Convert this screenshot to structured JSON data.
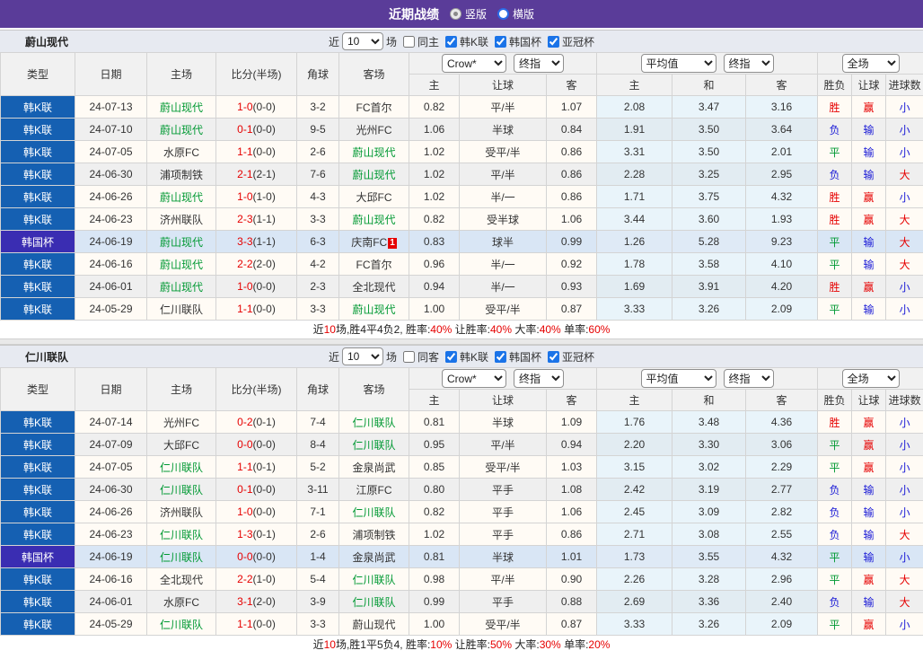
{
  "title_bar": {
    "title": "近期战绩",
    "radio_vertical": "竖版",
    "radio_horizontal": "横版"
  },
  "filter": {
    "near": "近",
    "count": "10",
    "games": "场",
    "leagues": [
      "韩K联",
      "韩国杯",
      "亚冠杯"
    ]
  },
  "dropdowns": {
    "company": "Crow*",
    "final1": "终指",
    "average": "平均值",
    "final2": "终指",
    "scope": "全场"
  },
  "cols": {
    "type": "类型",
    "date": "日期",
    "home": "主场",
    "score": "比分(半场)",
    "corner": "角球",
    "away": "客场",
    "home_odds": "主",
    "handicap": "让球",
    "away_odds": "客",
    "avg_home": "主",
    "avg_draw": "和",
    "avg_away": "客",
    "result": "胜负",
    "handicap_result": "让球",
    "goals": "进球数"
  },
  "colors": {
    "titlebar_bg": "#5a3c99",
    "league_bg": "#1560b2",
    "cup_bg": "#3a2db2",
    "team_green": "#009933",
    "score_red": "#e60000",
    "win_red": "#e60000",
    "lose_blue": "#1a1ad6",
    "draw_green": "#009933",
    "row_light": "#fffbf5",
    "row_gray": "#efefef",
    "row_highlight": "#d9e6f5",
    "avg_col_bg": "#e9f4fa"
  },
  "sections": [
    {
      "team": "蔚山现代",
      "same_label": "同主",
      "rows": [
        {
          "t": "韩K联",
          "cup": false,
          "d": "24-07-13",
          "h": "蔚山现代",
          "hg": true,
          "s": "1-0",
          "sh": "(0-0)",
          "c": "3-2",
          "a": "FC首尔",
          "ag": false,
          "o1": "0.82",
          "hc": "平/半",
          "o2": "1.07",
          "v1": "2.08",
          "v2": "3.47",
          "v3": "3.16",
          "r": "胜",
          "rc": "r",
          "hr": "赢",
          "hrc": "r",
          "g": "小",
          "gc": "b",
          "shade": "w"
        },
        {
          "t": "韩K联",
          "cup": false,
          "d": "24-07-10",
          "h": "蔚山现代",
          "hg": true,
          "s": "0-1",
          "sh": "(0-0)",
          "c": "9-5",
          "a": "光州FC",
          "ag": false,
          "o1": "1.06",
          "hc": "半球",
          "o2": "0.84",
          "v1": "1.91",
          "v2": "3.50",
          "v3": "3.64",
          "r": "负",
          "rc": "b",
          "hr": "输",
          "hrc": "b",
          "g": "小",
          "gc": "b",
          "shade": "g"
        },
        {
          "t": "韩K联",
          "cup": false,
          "d": "24-07-05",
          "h": "水原FC",
          "hg": false,
          "s": "1-1",
          "sh": "(0-0)",
          "c": "2-6",
          "a": "蔚山现代",
          "ag": true,
          "o1": "1.02",
          "hc": "受平/半",
          "o2": "0.86",
          "v1": "3.31",
          "v2": "3.50",
          "v3": "2.01",
          "r": "平",
          "rc": "g",
          "hr": "输",
          "hrc": "b",
          "g": "小",
          "gc": "b",
          "shade": "w"
        },
        {
          "t": "韩K联",
          "cup": false,
          "d": "24-06-30",
          "h": "浦项制铁",
          "hg": false,
          "s": "2-1",
          "sh": "(2-1)",
          "c": "7-6",
          "a": "蔚山现代",
          "ag": true,
          "o1": "1.02",
          "hc": "平/半",
          "o2": "0.86",
          "v1": "2.28",
          "v2": "3.25",
          "v3": "2.95",
          "r": "负",
          "rc": "b",
          "hr": "输",
          "hrc": "b",
          "g": "大",
          "gc": "r",
          "shade": "g"
        },
        {
          "t": "韩K联",
          "cup": false,
          "d": "24-06-26",
          "h": "蔚山现代",
          "hg": true,
          "s": "1-0",
          "sh": "(1-0)",
          "c": "4-3",
          "a": "大邱FC",
          "ag": false,
          "o1": "1.02",
          "hc": "半/一",
          "o2": "0.86",
          "v1": "1.71",
          "v2": "3.75",
          "v3": "4.32",
          "r": "胜",
          "rc": "r",
          "hr": "赢",
          "hrc": "r",
          "g": "小",
          "gc": "b",
          "shade": "w"
        },
        {
          "t": "韩K联",
          "cup": false,
          "d": "24-06-23",
          "h": "济州联队",
          "hg": false,
          "s": "2-3",
          "sh": "(1-1)",
          "c": "3-3",
          "a": "蔚山现代",
          "ag": true,
          "o1": "0.82",
          "hc": "受半球",
          "o2": "1.06",
          "v1": "3.44",
          "v2": "3.60",
          "v3": "1.93",
          "r": "胜",
          "rc": "r",
          "hr": "赢",
          "hrc": "r",
          "g": "大",
          "gc": "r",
          "shade": "w"
        },
        {
          "t": "韩国杯",
          "cup": true,
          "d": "24-06-19",
          "h": "蔚山现代",
          "hg": true,
          "s": "3-3",
          "sh": "(1-1)",
          "c": "6-3",
          "a": "庆南FC",
          "ag": false,
          "ab": "1",
          "o1": "0.83",
          "hc": "球半",
          "o2": "0.99",
          "v1": "1.26",
          "v2": "5.28",
          "v3": "9.23",
          "r": "平",
          "rc": "g",
          "hr": "输",
          "hrc": "b",
          "g": "大",
          "gc": "r",
          "shade": "hl"
        },
        {
          "t": "韩K联",
          "cup": false,
          "d": "24-06-16",
          "h": "蔚山现代",
          "hg": true,
          "s": "2-2",
          "sh": "(2-0)",
          "c": "4-2",
          "a": "FC首尔",
          "ag": false,
          "o1": "0.96",
          "hc": "半/一",
          "o2": "0.92",
          "v1": "1.78",
          "v2": "3.58",
          "v3": "4.10",
          "r": "平",
          "rc": "g",
          "hr": "输",
          "hrc": "b",
          "g": "大",
          "gc": "r",
          "shade": "w"
        },
        {
          "t": "韩K联",
          "cup": false,
          "d": "24-06-01",
          "h": "蔚山现代",
          "hg": true,
          "s": "1-0",
          "sh": "(0-0)",
          "c": "2-3",
          "a": "全北现代",
          "ag": false,
          "o1": "0.94",
          "hc": "半/一",
          "o2": "0.93",
          "v1": "1.69",
          "v2": "3.91",
          "v3": "4.20",
          "r": "胜",
          "rc": "r",
          "hr": "赢",
          "hrc": "r",
          "g": "小",
          "gc": "b",
          "shade": "g"
        },
        {
          "t": "韩K联",
          "cup": false,
          "d": "24-05-29",
          "h": "仁川联队",
          "hg": false,
          "s": "1-1",
          "sh": "(0-0)",
          "c": "3-3",
          "a": "蔚山现代",
          "ag": true,
          "o1": "1.00",
          "hc": "受平/半",
          "o2": "0.87",
          "v1": "3.33",
          "v2": "3.26",
          "v3": "2.09",
          "r": "平",
          "rc": "g",
          "hr": "输",
          "hrc": "b",
          "g": "小",
          "gc": "b",
          "shade": "w"
        }
      ],
      "summary": [
        [
          "近",
          "k"
        ],
        [
          "10",
          "r"
        ],
        [
          "场,胜4平4负2, 胜率:",
          "k"
        ],
        [
          "40%",
          "r"
        ],
        [
          " 让胜率:",
          "k"
        ],
        [
          "40%",
          "r"
        ],
        [
          " 大率:",
          "k"
        ],
        [
          "40%",
          "r"
        ],
        [
          " 单率:",
          "k"
        ],
        [
          "60%",
          "r"
        ]
      ]
    },
    {
      "team": "仁川联队",
      "same_label": "同客",
      "rows": [
        {
          "t": "韩K联",
          "cup": false,
          "d": "24-07-14",
          "h": "光州FC",
          "hg": false,
          "s": "0-2",
          "sh": "(0-1)",
          "c": "7-4",
          "a": "仁川联队",
          "ag": true,
          "o1": "0.81",
          "hc": "半球",
          "o2": "1.09",
          "v1": "1.76",
          "v2": "3.48",
          "v3": "4.36",
          "r": "胜",
          "rc": "r",
          "hr": "赢",
          "hrc": "r",
          "g": "小",
          "gc": "b",
          "shade": "w"
        },
        {
          "t": "韩K联",
          "cup": false,
          "d": "24-07-09",
          "h": "大邱FC",
          "hg": false,
          "s": "0-0",
          "sh": "(0-0)",
          "c": "8-4",
          "a": "仁川联队",
          "ag": true,
          "o1": "0.95",
          "hc": "平/半",
          "o2": "0.94",
          "v1": "2.20",
          "v2": "3.30",
          "v3": "3.06",
          "r": "平",
          "rc": "g",
          "hr": "赢",
          "hrc": "r",
          "g": "小",
          "gc": "b",
          "shade": "g"
        },
        {
          "t": "韩K联",
          "cup": false,
          "d": "24-07-05",
          "h": "仁川联队",
          "hg": true,
          "s": "1-1",
          "sh": "(0-1)",
          "c": "5-2",
          "a": "金泉尚武",
          "ag": false,
          "o1": "0.85",
          "hc": "受平/半",
          "o2": "1.03",
          "v1": "3.15",
          "v2": "3.02",
          "v3": "2.29",
          "r": "平",
          "rc": "g",
          "hr": "赢",
          "hrc": "r",
          "g": "小",
          "gc": "b",
          "shade": "w"
        },
        {
          "t": "韩K联",
          "cup": false,
          "d": "24-06-30",
          "h": "仁川联队",
          "hg": true,
          "s": "0-1",
          "sh": "(0-0)",
          "c": "3-11",
          "a": "江原FC",
          "ag": false,
          "o1": "0.80",
          "hc": "平手",
          "o2": "1.08",
          "v1": "2.42",
          "v2": "3.19",
          "v3": "2.77",
          "r": "负",
          "rc": "b",
          "hr": "输",
          "hrc": "b",
          "g": "小",
          "gc": "b",
          "shade": "g"
        },
        {
          "t": "韩K联",
          "cup": false,
          "d": "24-06-26",
          "h": "济州联队",
          "hg": false,
          "s": "1-0",
          "sh": "(0-0)",
          "c": "7-1",
          "a": "仁川联队",
          "ag": true,
          "o1": "0.82",
          "hc": "平手",
          "o2": "1.06",
          "v1": "2.45",
          "v2": "3.09",
          "v3": "2.82",
          "r": "负",
          "rc": "b",
          "hr": "输",
          "hrc": "b",
          "g": "小",
          "gc": "b",
          "shade": "w"
        },
        {
          "t": "韩K联",
          "cup": false,
          "d": "24-06-23",
          "h": "仁川联队",
          "hg": true,
          "s": "1-3",
          "sh": "(0-1)",
          "c": "2-6",
          "a": "浦项制铁",
          "ag": false,
          "o1": "1.02",
          "hc": "平手",
          "o2": "0.86",
          "v1": "2.71",
          "v2": "3.08",
          "v3": "2.55",
          "r": "负",
          "rc": "b",
          "hr": "输",
          "hrc": "b",
          "g": "大",
          "gc": "r",
          "shade": "w"
        },
        {
          "t": "韩国杯",
          "cup": true,
          "d": "24-06-19",
          "h": "仁川联队",
          "hg": true,
          "s": "0-0",
          "sh": "(0-0)",
          "c": "1-4",
          "a": "金泉尚武",
          "ag": false,
          "o1": "0.81",
          "hc": "半球",
          "o2": "1.01",
          "v1": "1.73",
          "v2": "3.55",
          "v3": "4.32",
          "r": "平",
          "rc": "g",
          "hr": "输",
          "hrc": "b",
          "g": "小",
          "gc": "b",
          "shade": "hl"
        },
        {
          "t": "韩K联",
          "cup": false,
          "d": "24-06-16",
          "h": "全北现代",
          "hg": false,
          "s": "2-2",
          "sh": "(1-0)",
          "c": "5-4",
          "a": "仁川联队",
          "ag": true,
          "o1": "0.98",
          "hc": "平/半",
          "o2": "0.90",
          "v1": "2.26",
          "v2": "3.28",
          "v3": "2.96",
          "r": "平",
          "rc": "g",
          "hr": "赢",
          "hrc": "r",
          "g": "大",
          "gc": "r",
          "shade": "w"
        },
        {
          "t": "韩K联",
          "cup": false,
          "d": "24-06-01",
          "h": "水原FC",
          "hg": false,
          "s": "3-1",
          "sh": "(2-0)",
          "c": "3-9",
          "a": "仁川联队",
          "ag": true,
          "o1": "0.99",
          "hc": "平手",
          "o2": "0.88",
          "v1": "2.69",
          "v2": "3.36",
          "v3": "2.40",
          "r": "负",
          "rc": "b",
          "hr": "输",
          "hrc": "b",
          "g": "大",
          "gc": "r",
          "shade": "g"
        },
        {
          "t": "韩K联",
          "cup": false,
          "d": "24-05-29",
          "h": "仁川联队",
          "hg": true,
          "s": "1-1",
          "sh": "(0-0)",
          "c": "3-3",
          "a": "蔚山现代",
          "ag": false,
          "o1": "1.00",
          "hc": "受平/半",
          "o2": "0.87",
          "v1": "3.33",
          "v2": "3.26",
          "v3": "2.09",
          "r": "平",
          "rc": "g",
          "hr": "赢",
          "hrc": "r",
          "g": "小",
          "gc": "b",
          "shade": "w"
        }
      ],
      "summary": [
        [
          "近",
          "k"
        ],
        [
          "10",
          "r"
        ],
        [
          "场,胜1平5负4, 胜率:",
          "k"
        ],
        [
          "10%",
          "r"
        ],
        [
          " 让胜率:",
          "k"
        ],
        [
          "50%",
          "r"
        ],
        [
          " 大率:",
          "k"
        ],
        [
          "30%",
          "r"
        ],
        [
          " 单率:",
          "k"
        ],
        [
          "20%",
          "r"
        ]
      ]
    }
  ]
}
